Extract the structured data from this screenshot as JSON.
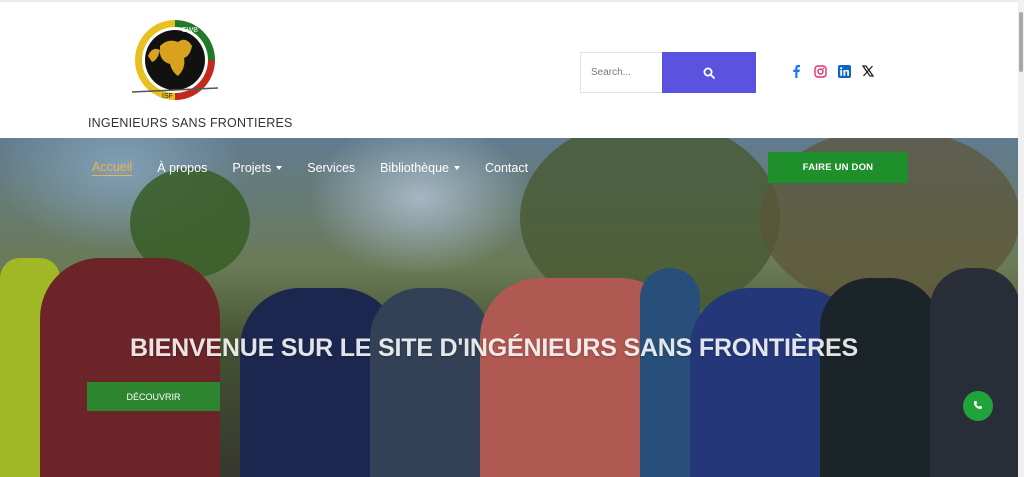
{
  "header": {
    "logo_top_text": "EWB",
    "logo_bottom_text": "ISF",
    "org_name": "INGENIEURS SANS FRONTIERES"
  },
  "search": {
    "placeholder": "Search...",
    "button_icon": "search-icon"
  },
  "socials": [
    {
      "name": "facebook-icon",
      "color": "#1877f2"
    },
    {
      "name": "instagram-icon",
      "color": "#e1306c"
    },
    {
      "name": "linkedin-icon",
      "color": "#0a66c2"
    },
    {
      "name": "x-twitter-icon",
      "color": "#222222"
    }
  ],
  "nav": {
    "items": [
      {
        "label": "Accueil",
        "active": true,
        "dropdown": false
      },
      {
        "label": "À propos",
        "active": false,
        "dropdown": false
      },
      {
        "label": "Projets",
        "active": false,
        "dropdown": true
      },
      {
        "label": "Services",
        "active": false,
        "dropdown": false
      },
      {
        "label": "Bibliothèque",
        "active": false,
        "dropdown": true
      },
      {
        "label": "Contact",
        "active": false,
        "dropdown": false
      }
    ],
    "donate_label": "FAIRE UN DON"
  },
  "hero": {
    "title": "BIENVENUE SUR LE SITE D'INGÉNIEURS SANS FRONTIÈRES",
    "button_label": "DÉCOUVRIR"
  },
  "colors": {
    "accent": "#5b52e0",
    "donate": "#1e8f2a",
    "active_nav": "#f0b24a",
    "fab": "#1fa33a"
  },
  "fab_icon": "phone-icon"
}
